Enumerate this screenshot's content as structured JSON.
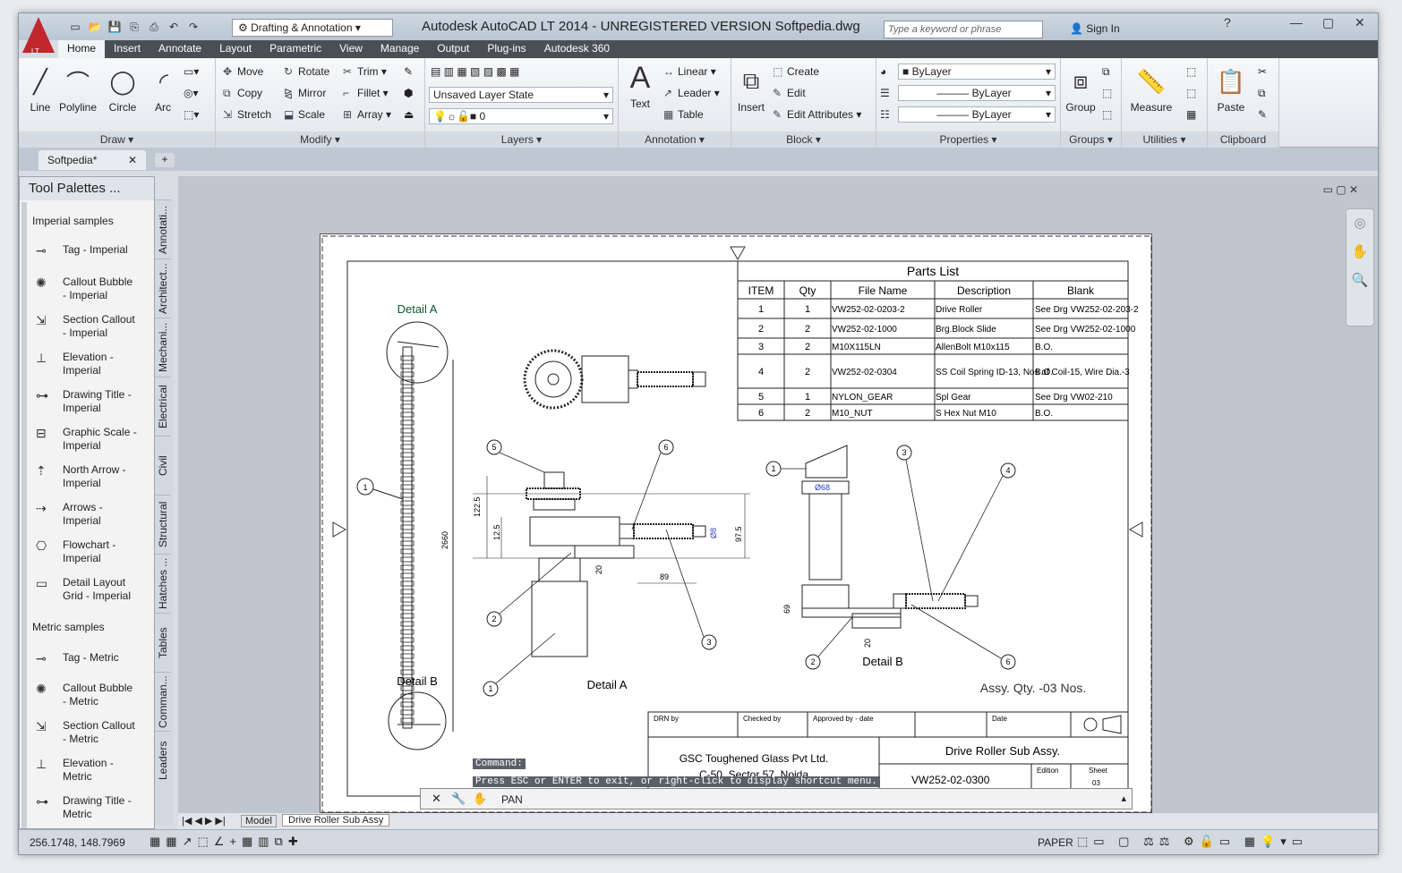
{
  "window": {
    "title": "Autodesk AutoCAD LT 2014 - UNREGISTERED VERSION      Softpedia.dwg",
    "workspace": "Drafting & Annotation",
    "search_placeholder": "Type a keyword or phrase",
    "signin": "Sign In",
    "app_label": "LT"
  },
  "ribbon": {
    "tabs": [
      "Home",
      "Insert",
      "Annotate",
      "Layout",
      "Parametric",
      "View",
      "Manage",
      "Output",
      "Plug-ins",
      "Autodesk 360"
    ],
    "draw": {
      "title": "Draw",
      "items": [
        "Line",
        "Polyline",
        "Circle",
        "Arc"
      ]
    },
    "modify": {
      "title": "Modify",
      "items": [
        "Move",
        "Rotate",
        "Trim",
        "Copy",
        "Mirror",
        "Fillet",
        "Stretch",
        "Scale",
        "Array"
      ]
    },
    "layers": {
      "title": "Layers",
      "state": "Unsaved Layer State",
      "layer": "0"
    },
    "annotation": {
      "title": "Annotation",
      "text": "Text",
      "linear": "Linear",
      "leader": "Leader",
      "table": "Table"
    },
    "block": {
      "title": "Block",
      "insert": "Insert",
      "create": "Create",
      "edit": "Edit",
      "edit_attributes": "Edit Attributes"
    },
    "properties": {
      "title": "Properties",
      "color": "ByLayer",
      "linetype": "ByLayer",
      "lineweight": "ByLayer"
    },
    "groups": {
      "title": "Groups",
      "group": "Group"
    },
    "utilities": {
      "title": "Utilities",
      "measure": "Measure"
    },
    "clipboard": {
      "title": "Clipboard",
      "paste": "Paste"
    }
  },
  "doc_tab": "Softpedia*",
  "palette": {
    "title": "Tool Palettes ...",
    "sec1": "Imperial samples",
    "sec2": "Metric samples",
    "items": [
      [
        "Tag - Imperial"
      ],
      [
        "Callout Bubble",
        "- Imperial"
      ],
      [
        "Section Callout",
        "- Imperial"
      ],
      [
        "Elevation -",
        "Imperial"
      ],
      [
        "Drawing Title -",
        "Imperial"
      ],
      [
        "Graphic Scale -",
        "Imperial"
      ],
      [
        "North Arrow -",
        "Imperial"
      ],
      [
        "Arrows -",
        "Imperial"
      ],
      [
        "Flowchart -",
        "Imperial"
      ],
      [
        "Detail Layout",
        "Grid - Imperial"
      ],
      [
        "Tag - Metric"
      ],
      [
        "Callout Bubble",
        "- Metric"
      ],
      [
        "Section Callout",
        "- Metric"
      ],
      [
        "Elevation -",
        "Metric"
      ],
      [
        "Drawing Title -",
        "Metric"
      ]
    ],
    "side_tabs": [
      "Annotati...",
      "Architect...",
      "Mechani...",
      "Electrical",
      "Civil",
      "Structural",
      "Hatches ...",
      "Tables",
      "Comman...",
      "Leaders"
    ]
  },
  "drawing": {
    "parts_title": "Parts List",
    "headers": [
      "ITEM",
      "Qty",
      "File Name",
      "Description",
      "Blank"
    ],
    "rows": [
      [
        "1",
        "1",
        "VW252-02-0203-2",
        "Drive Roller",
        "See Drg VW252-02-203-2"
      ],
      [
        "2",
        "2",
        "VW252-02-1000",
        "Brg.Block Slide",
        "See Drg VW252-02-1000"
      ],
      [
        "3",
        "2",
        "M10X115LN",
        "AllenBolt M10x115",
        "B.O."
      ],
      [
        "4",
        "2",
        "VW252-02-0304",
        "SS Coil Spring ID-13, Nos of Coil-15, Wire Dia.-3",
        "B.O."
      ],
      [
        "5",
        "1",
        "NYLON_GEAR",
        "Spl Gear",
        "See Drg VW02-210"
      ],
      [
        "6",
        "2",
        "M10_NUT",
        "S Hex Nut M10",
        "B.O."
      ]
    ],
    "detail_a": "Detail A",
    "detail_b": "Detail B",
    "assy_qty": "Assy. Qty. -03 Nos.",
    "tb": {
      "drn": "DRN by",
      "checked": "Checked by",
      "approved": "Approved by - date",
      "date": "Date",
      "company": "GSC Toughened Glass Pvt Ltd.",
      "address": "C-50, Sector 57, Noida",
      "title": "Drive Roller Sub Assy.",
      "dwg": "VW252-02-0300",
      "edition": "Edition",
      "sheet": "Sheet",
      "sheet_no": "03"
    },
    "dims": {
      "d122": "122.5",
      "d12": "12.5",
      "d97": "97.5",
      "d89": "89",
      "d20": "20",
      "d2660": "2660",
      "d69": "69",
      "d20b": "20",
      "d68": "Ø68",
      "d8": "Ø8"
    }
  },
  "command": {
    "label": "Command:",
    "prompt": "Press ESC or ENTER to exit, or right-click to display shortcut menu.",
    "current": "PAN"
  },
  "layout_tabs": [
    "Model",
    "Drive Roller Sub Assy"
  ],
  "status": {
    "coords": "256.1748, 148.7969",
    "paper": "PAPER"
  }
}
